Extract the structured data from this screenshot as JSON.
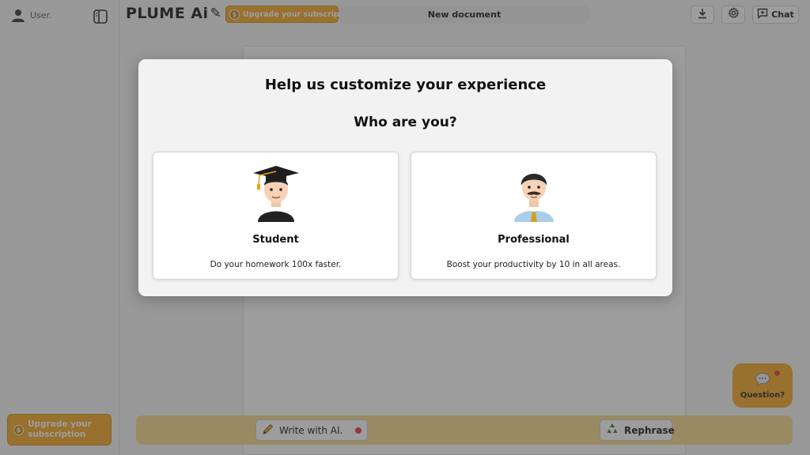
{
  "sidebar": {
    "user_label": "User.",
    "upgrade_label": "Upgrade your subscription"
  },
  "topbar": {
    "logo_text": "PLUME Ai",
    "upgrade_label": "Upgrade your subscription",
    "document_title": "New document",
    "chat_label": "Chat"
  },
  "bottom": {
    "write_ai_label": "Write with AI.",
    "rephrase_label": "Rephrase"
  },
  "question": {
    "label": "Question?"
  },
  "modal": {
    "title": "Help us customize your experience",
    "subtitle": "Who are you?",
    "options": [
      {
        "title": "Student",
        "description": "Do your homework 100x faster.",
        "icon": "student-emoji"
      },
      {
        "title": "Professional",
        "description": "Boost your productivity by 10 in all areas.",
        "icon": "professional-emoji"
      }
    ]
  },
  "colors": {
    "accent": "#f5a623",
    "bottom_bar": "#f7d98a",
    "notification_dot": "#e53935",
    "overlay": "rgba(60,60,60,0.5)"
  }
}
